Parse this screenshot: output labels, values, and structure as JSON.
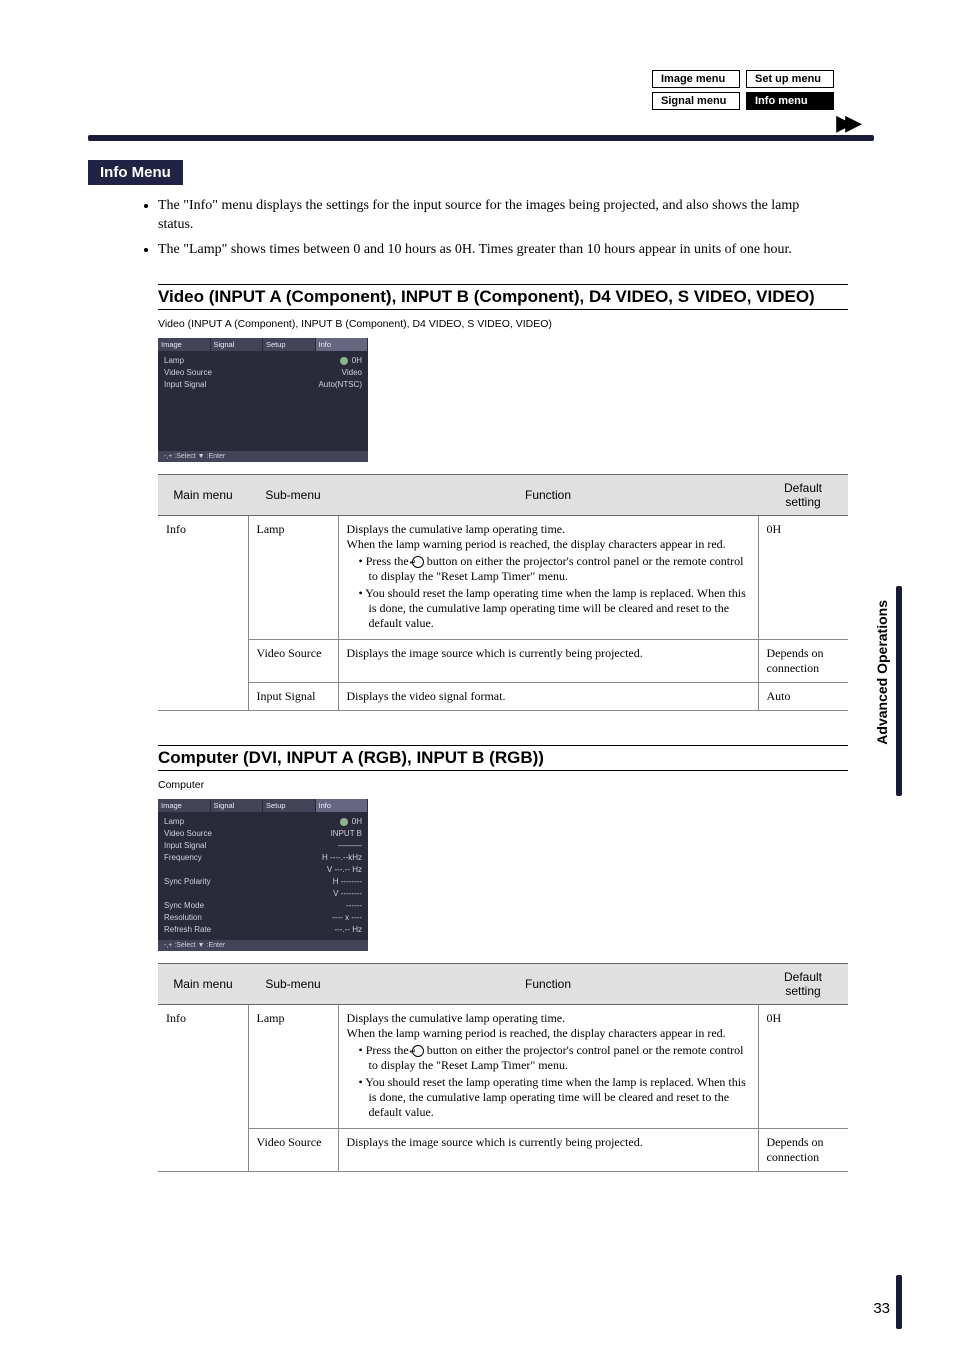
{
  "menuBoxes": {
    "image": "Image menu",
    "setup": "Set up menu",
    "signal": "Signal menu",
    "info": "Info menu"
  },
  "infoMenu": {
    "title": "Info Menu",
    "bullets": [
      "The \"Info\" menu displays the settings for the input source for the images being projected, and also shows the lamp status.",
      "The \"Lamp\" shows times between 0 and 10 hours as 0H. Times greater than 10 hours appear in units of one hour."
    ]
  },
  "section1": {
    "heading": "Video (INPUT A (Component), INPUT B (Component), D4 VIDEO, S VIDEO, VIDEO)",
    "caption": "Video (INPUT A (Component), INPUT B (Component), D4 VIDEO, S VIDEO, VIDEO)",
    "osd": {
      "tabs": [
        "Image",
        "Signal",
        "Setup",
        "Info"
      ],
      "rows": {
        "lamp_lbl": "Lamp",
        "lamp_val": "0H",
        "vsrc_lbl": "Video Source",
        "vsrc_val": "Video",
        "isig_lbl": "Input Signal",
        "isig_val": "Auto(NTSC)"
      },
      "foot": "-,+ :Select   ▼ :Enter"
    }
  },
  "section2": {
    "heading": "Computer (DVI, INPUT A (RGB), INPUT B (RGB))",
    "caption": "Computer",
    "osd": {
      "tabs": [
        "Image",
        "Signal",
        "Setup",
        "Info"
      ],
      "rows": {
        "lamp_lbl": "Lamp",
        "lamp_val": "0H",
        "vsrc_lbl": "Video Source",
        "vsrc_val": "INPUT B",
        "isig_lbl": "Input Signal",
        "isig_val": "———",
        "freq_lbl": "Frequency",
        "freq_h": "H    ----.--kHz",
        "freq_v": "V     ---.-- Hz",
        "spol_lbl": "Sync Polarity",
        "spol_h": "H   --------",
        "spol_v": "V   --------",
        "smode_lbl": "Sync Mode",
        "smode_val": "------",
        "res_lbl": "Resolution",
        "res_val": "----  x  ----",
        "rr_lbl": "Refresh Rate",
        "rr_val": "---.-- Hz"
      },
      "foot": "-,+ :Select   ▼ :Enter"
    }
  },
  "tableHeaders": {
    "main": "Main menu",
    "sub": "Sub-menu",
    "func": "Function",
    "def": "Default setting"
  },
  "table1": {
    "main": "Info",
    "rows": [
      {
        "sub": "Lamp",
        "func_lead": "Displays the cumulative lamp operating time.",
        "func_line2": "When the lamp warning period is reached, the display characters appear in red.",
        "func_b1a": "Press the ",
        "func_b1b": " button on either the projector's control panel or the remote control to display the \"Reset Lamp Timer\" menu.",
        "func_b2": "You should reset the lamp operating time when the lamp is replaced. When this is done, the cumulative lamp operating time will be cleared and reset to the default value.",
        "def": "0H"
      },
      {
        "sub": "Video Source",
        "func_lead": "Displays the image source which is currently being projected.",
        "def": "Depends on connection"
      },
      {
        "sub": "Input Signal",
        "func_lead": "Displays the video signal format.",
        "def": "Auto"
      }
    ]
  },
  "table2": {
    "main": "Info",
    "rows": [
      {
        "sub": "Lamp",
        "func_lead": "Displays the cumulative lamp operating time.",
        "func_line2": "When the lamp warning period is reached, the display characters appear in red.",
        "func_b1a": "Press the ",
        "func_b1b": " button on either the projector's control panel or the remote control to display the \"Reset Lamp Timer\" menu.",
        "func_b2": "You should reset the lamp operating time when the lamp is replaced. When this is done, the cumulative lamp operating time will be cleared and reset to the default value.",
        "def": "0H"
      },
      {
        "sub": "Video Source",
        "func_lead": "Displays the image source which is currently being projected.",
        "def": "Depends on connection"
      }
    ]
  },
  "sideTab": "Advanced Operations",
  "pageNum": "33"
}
